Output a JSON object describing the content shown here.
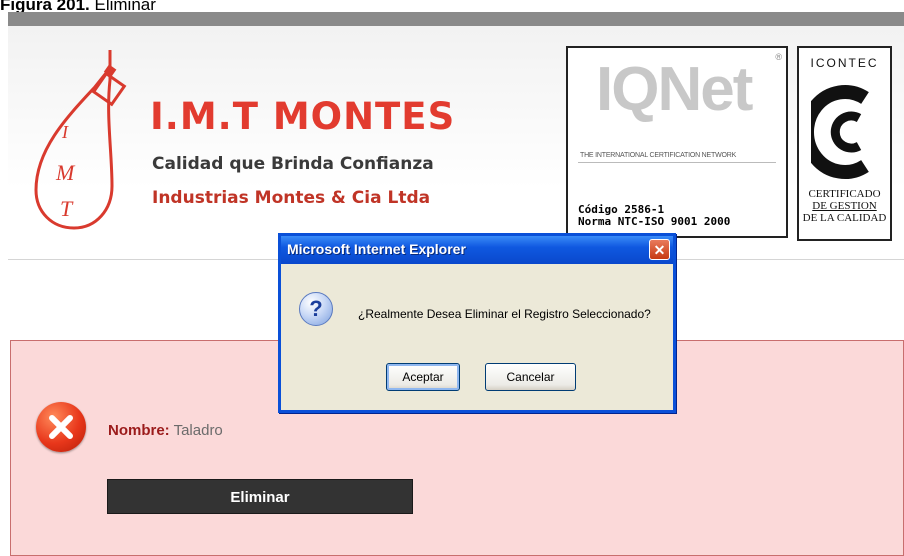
{
  "caption": {
    "prefix": "Figura 201.",
    "text": " Eliminar"
  },
  "header": {
    "company_name": "I.M.T MONTES",
    "slogan": "Calidad que Brinda Confianza",
    "legal_name": "Industrias Montes & Cia Ltda",
    "logo_letters": "IMT"
  },
  "iqnet": {
    "brand": "IQNet",
    "network": "THE INTERNATIONAL CERTIFICATION NETWORK",
    "code_line": "Código 2586-1",
    "norm_line": "Norma NTC-ISO 9001 2000"
  },
  "icontec": {
    "brand": "ICONTEC",
    "cert_line1": "CERTIFICADO",
    "cert_line2": "DE GESTION",
    "cert_line3": "DE LA CALIDAD"
  },
  "record": {
    "label": "Nombre:",
    "value": "Taladro"
  },
  "delete_button": "Eliminar",
  "dialog": {
    "title": "Microsoft Internet Explorer",
    "message": "¿Realmente Desea Eliminar el Registro Seleccionado?",
    "ok_label": "Aceptar",
    "cancel_label": "Cancelar",
    "close_glyph": "✕"
  },
  "colors": {
    "brand_red": "#e23b2f",
    "content_bg": "#fbd9d9",
    "dialog_blue": "#0a50d8"
  }
}
